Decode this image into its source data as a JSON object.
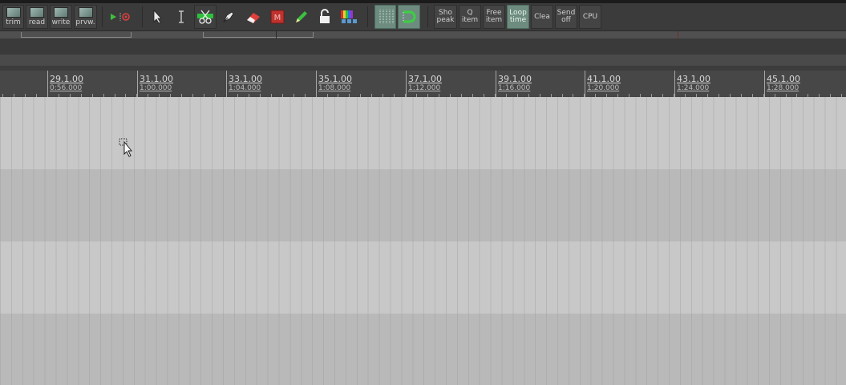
{
  "toolbar": {
    "envelope_buttons": [
      {
        "label": "trim"
      },
      {
        "label": "read"
      },
      {
        "label": "write"
      },
      {
        "label": "prvw."
      }
    ],
    "tool_icons": [
      "play-record-icon",
      "pointer-icon",
      "text-cursor-icon",
      "split-scissors-icon",
      "marker-pen-icon",
      "eraser-icon",
      "mute-icon",
      "pencil-icon",
      "lock-icon",
      "color-icon",
      "grid-icon",
      "snap-icon"
    ],
    "text_buttons": [
      {
        "line1": "Sho",
        "line2": "peak",
        "active": false
      },
      {
        "line1": "Q",
        "line2": "item",
        "active": false
      },
      {
        "line1": "Free",
        "line2": "item",
        "active": false
      },
      {
        "line1": "Loop",
        "line2": "time",
        "active": true
      },
      {
        "line1": "Clea",
        "line2": "",
        "active": false
      },
      {
        "line1": "Send",
        "line2": "off",
        "active": false
      },
      {
        "line1": "CPU",
        "line2": "",
        "active": false
      }
    ]
  },
  "ruler": {
    "marks": [
      {
        "bar": "29.1.00",
        "time": "0:56.000"
      },
      {
        "bar": "31.1.00",
        "time": "1:00.000"
      },
      {
        "bar": "33.1.00",
        "time": "1:04.000"
      },
      {
        "bar": "35.1.00",
        "time": "1:08.000"
      },
      {
        "bar": "37.1.00",
        "time": "1:12.000"
      },
      {
        "bar": "39.1.00",
        "time": "1:16.000"
      },
      {
        "bar": "41.1.00",
        "time": "1:20.000"
      },
      {
        "bar": "43.1.00",
        "time": "1:24.000"
      },
      {
        "bar": "45.1.00",
        "time": "1:28.000"
      }
    ]
  },
  "colors": {
    "lane_light": "#c8c8c8",
    "lane_dark": "#b9b9b9",
    "toolbar_bg": "#3b3b3b",
    "active_button": "#6d8c7f"
  }
}
